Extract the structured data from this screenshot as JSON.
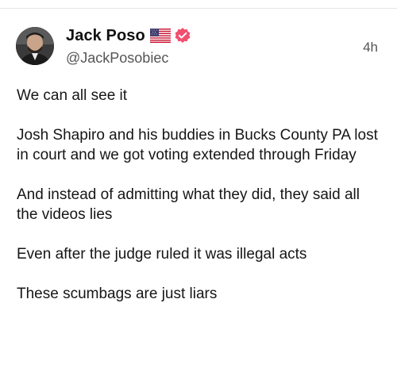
{
  "post": {
    "author": {
      "display_name": "Jack Poso",
      "handle": "@JackPosobiec",
      "avatar_icon": "profile-photo",
      "badges": [
        "us-flag-icon",
        "verified-icon"
      ],
      "verified_color": "#F0506E"
    },
    "timestamp": "4h",
    "paragraphs": [
      "We can all see it",
      "Josh Shapiro and his buddies in Bucks County PA lost in court and we got voting extended through Friday",
      "And instead of admitting what they did, they said all the videos lies",
      "Even after the judge ruled it was illegal acts",
      "These scumbags are just liars"
    ]
  }
}
